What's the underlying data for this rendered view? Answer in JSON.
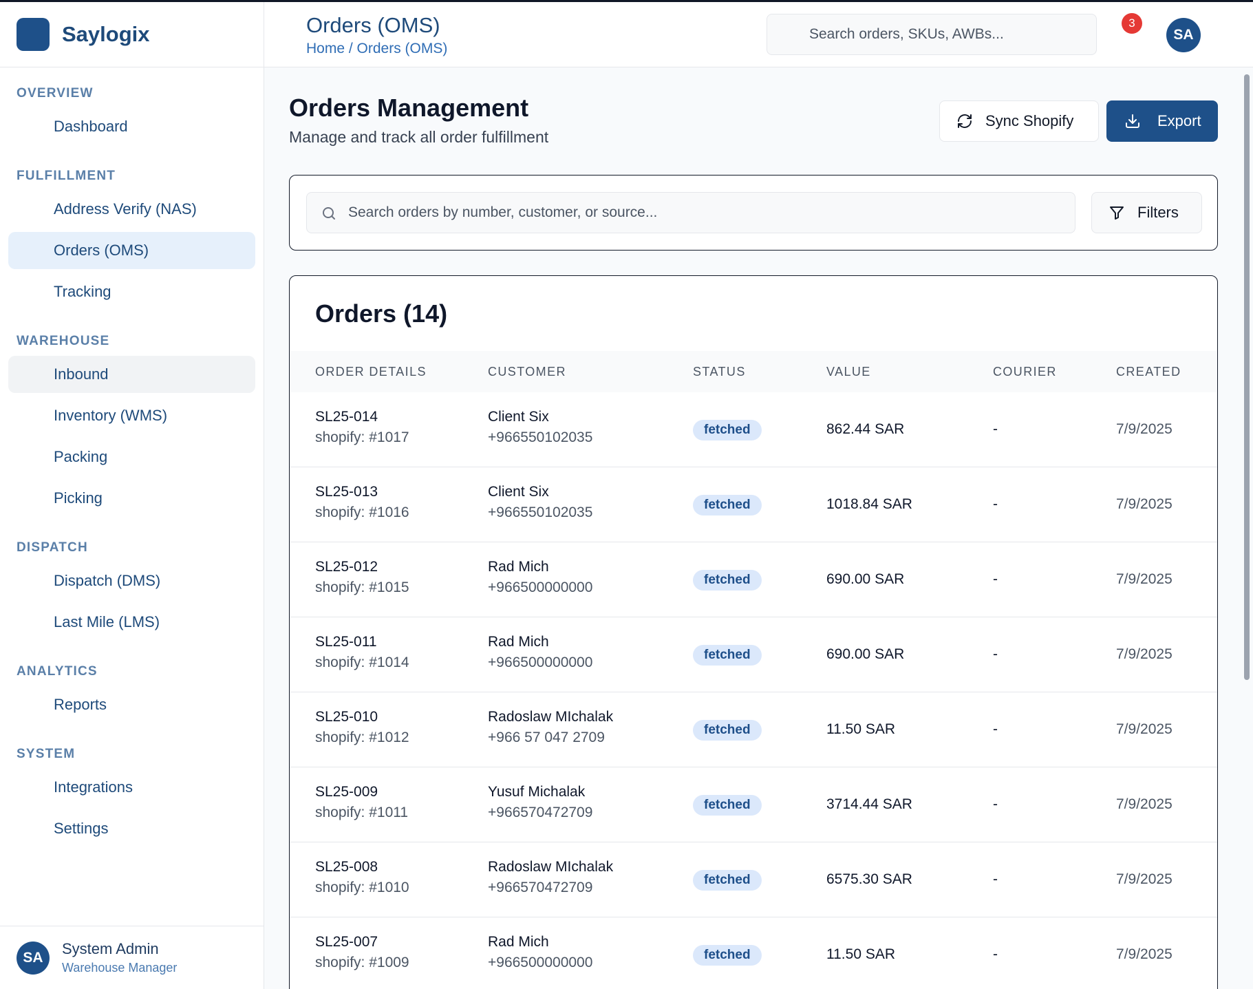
{
  "brand": {
    "name": "Saylogix"
  },
  "sidebar": {
    "sections": [
      {
        "title": "OVERVIEW",
        "items": [
          {
            "label": "Dashboard",
            "state": ""
          }
        ]
      },
      {
        "title": "FULFILLMENT",
        "items": [
          {
            "label": "Address Verify (NAS)",
            "state": ""
          },
          {
            "label": "Orders (OMS)",
            "state": "active"
          },
          {
            "label": "Tracking",
            "state": ""
          }
        ]
      },
      {
        "title": "WAREHOUSE",
        "items": [
          {
            "label": "Inbound",
            "state": "hover"
          },
          {
            "label": "Inventory (WMS)",
            "state": ""
          },
          {
            "label": "Packing",
            "state": ""
          },
          {
            "label": "Picking",
            "state": ""
          }
        ]
      },
      {
        "title": "DISPATCH",
        "items": [
          {
            "label": "Dispatch (DMS)",
            "state": ""
          },
          {
            "label": "Last Mile (LMS)",
            "state": ""
          }
        ]
      },
      {
        "title": "ANALYTICS",
        "items": [
          {
            "label": "Reports",
            "state": ""
          }
        ]
      },
      {
        "title": "SYSTEM",
        "items": [
          {
            "label": "Integrations",
            "state": ""
          },
          {
            "label": "Settings",
            "state": ""
          }
        ]
      }
    ],
    "user": {
      "initials": "SA",
      "name": "System Admin",
      "role": "Warehouse Manager"
    }
  },
  "header": {
    "title": "Orders (OMS)",
    "breadcrumb": "Home / Orders (OMS)",
    "search_placeholder": "Search orders, SKUs, AWBs...",
    "notification_count": "3",
    "avatar_initials": "SA"
  },
  "page": {
    "title": "Orders Management",
    "subtitle": "Manage and track all order fulfillment",
    "sync_label": "Sync Shopify",
    "export_label": "Export",
    "search_placeholder": "Search orders by number, customer, or source...",
    "filters_label": "Filters"
  },
  "orders": {
    "title": "Orders (14)",
    "columns": [
      "ORDER DETAILS",
      "CUSTOMER",
      "STATUS",
      "VALUE",
      "COURIER",
      "CREATED"
    ],
    "rows": [
      {
        "order": "SL25-014",
        "source": "shopify: #1017",
        "customer": "Client Six",
        "phone": "+966550102035",
        "status": "fetched",
        "value": "862.44 SAR",
        "courier": "-",
        "created": "7/9/2025"
      },
      {
        "order": "SL25-013",
        "source": "shopify: #1016",
        "customer": "Client Six",
        "phone": "+966550102035",
        "status": "fetched",
        "value": "1018.84 SAR",
        "courier": "-",
        "created": "7/9/2025"
      },
      {
        "order": "SL25-012",
        "source": "shopify: #1015",
        "customer": "Rad Mich",
        "phone": "+966500000000",
        "status": "fetched",
        "value": "690.00 SAR",
        "courier": "-",
        "created": "7/9/2025"
      },
      {
        "order": "SL25-011",
        "source": "shopify: #1014",
        "customer": "Rad Mich",
        "phone": "+966500000000",
        "status": "fetched",
        "value": "690.00 SAR",
        "courier": "-",
        "created": "7/9/2025"
      },
      {
        "order": "SL25-010",
        "source": "shopify: #1012",
        "customer": "Radoslaw MIchalak",
        "phone": "+966 57 047 2709",
        "status": "fetched",
        "value": "11.50 SAR",
        "courier": "-",
        "created": "7/9/2025"
      },
      {
        "order": "SL25-009",
        "source": "shopify: #1011",
        "customer": "Yusuf Michalak",
        "phone": "+966570472709",
        "status": "fetched",
        "value": "3714.44 SAR",
        "courier": "-",
        "created": "7/9/2025"
      },
      {
        "order": "SL25-008",
        "source": "shopify: #1010",
        "customer": "Radoslaw MIchalak",
        "phone": "+966570472709",
        "status": "fetched",
        "value": "6575.30 SAR",
        "courier": "-",
        "created": "7/9/2025"
      },
      {
        "order": "SL25-007",
        "source": "shopify: #1009",
        "customer": "Rad Mich",
        "phone": "+966500000000",
        "status": "fetched",
        "value": "11.50 SAR",
        "courier": "-",
        "created": "7/9/2025"
      }
    ]
  },
  "colors": {
    "primary": "#1e5089",
    "accent_text": "#1e4a7a",
    "badge_bg": "#dbe8fb",
    "badge_text": "#1e4f8a",
    "notification": "#e53935"
  }
}
